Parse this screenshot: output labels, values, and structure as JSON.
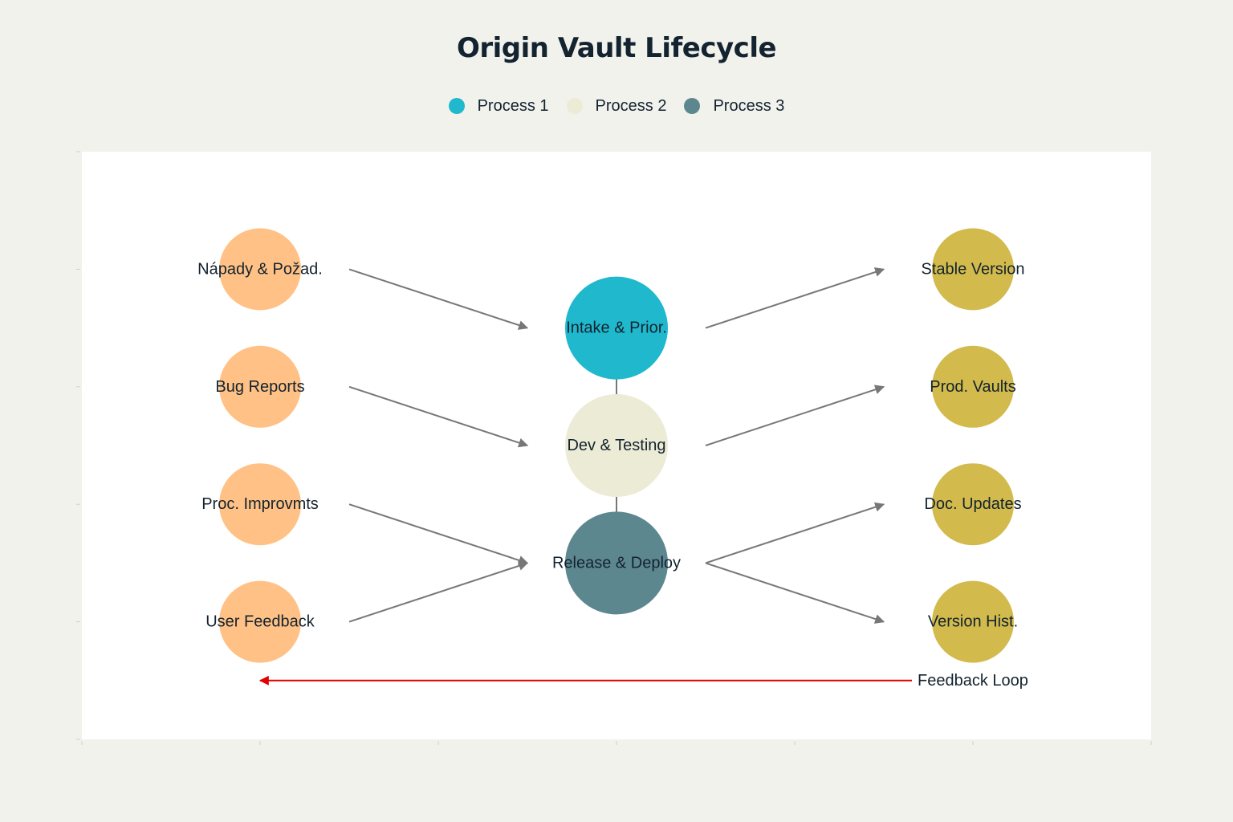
{
  "title": "Origin Vault Lifecycle",
  "colors": {
    "background": "#f2f2ed",
    "plot_background": "#ffffff",
    "input_nodes": "#ffc185",
    "output_nodes": "#d2ba4c",
    "edge": "#777777",
    "feedback_edge": "#e00000",
    "text": "#13232f"
  },
  "legend": [
    {
      "label": "Process 1",
      "color": "#1fb8cd"
    },
    {
      "label": "Process 2",
      "color": "#ecebd5"
    },
    {
      "label": "Process 3",
      "color": "#5d878f"
    }
  ],
  "chart_data": {
    "type": "flow-diagram",
    "title": "Origin Vault Lifecycle",
    "xlim": [
      0,
      6
    ],
    "ylim": [
      0,
      5
    ],
    "inputs": [
      {
        "id": "in1",
        "label": "Nápady & Požad.",
        "x": 1,
        "y": 4
      },
      {
        "id": "in2",
        "label": "Bug Reports",
        "x": 1,
        "y": 3
      },
      {
        "id": "in3",
        "label": "Proc. Improvmts",
        "x": 1,
        "y": 2
      },
      {
        "id": "in4",
        "label": "User Feedback",
        "x": 1,
        "y": 1
      }
    ],
    "processes": [
      {
        "id": "p1",
        "label": "Intake & Prior.",
        "x": 3,
        "y": 3.5,
        "series": "Process 1",
        "color": "#1fb8cd"
      },
      {
        "id": "p2",
        "label": "Dev & Testing",
        "x": 3,
        "y": 2.5,
        "series": "Process 2",
        "color": "#ecebd5"
      },
      {
        "id": "p3",
        "label": "Release & Deploy",
        "x": 3,
        "y": 1.5,
        "series": "Process 3",
        "color": "#5d878f"
      }
    ],
    "outputs": [
      {
        "id": "out1",
        "label": "Stable Version",
        "x": 5,
        "y": 4
      },
      {
        "id": "out2",
        "label": "Prod. Vaults",
        "x": 5,
        "y": 3
      },
      {
        "id": "out3",
        "label": "Doc. Updates",
        "x": 5,
        "y": 2
      },
      {
        "id": "out4",
        "label": "Version Hist.",
        "x": 5,
        "y": 1
      }
    ],
    "edges": [
      {
        "from": "in1",
        "to": "p1"
      },
      {
        "from": "in2",
        "to": "p2"
      },
      {
        "from": "in3",
        "to": "p3"
      },
      {
        "from": "in4",
        "to": "p3"
      },
      {
        "from": "p1",
        "to": "out1"
      },
      {
        "from": "p2",
        "to": "out2"
      },
      {
        "from": "p3",
        "to": "out3"
      },
      {
        "from": "p3",
        "to": "out4"
      },
      {
        "from": "p1",
        "to": "p2"
      },
      {
        "from": "p2",
        "to": "p3"
      }
    ],
    "feedback": {
      "label": "Feedback Loop",
      "from_x": 5,
      "to_x": 1,
      "y": 0.5
    }
  }
}
